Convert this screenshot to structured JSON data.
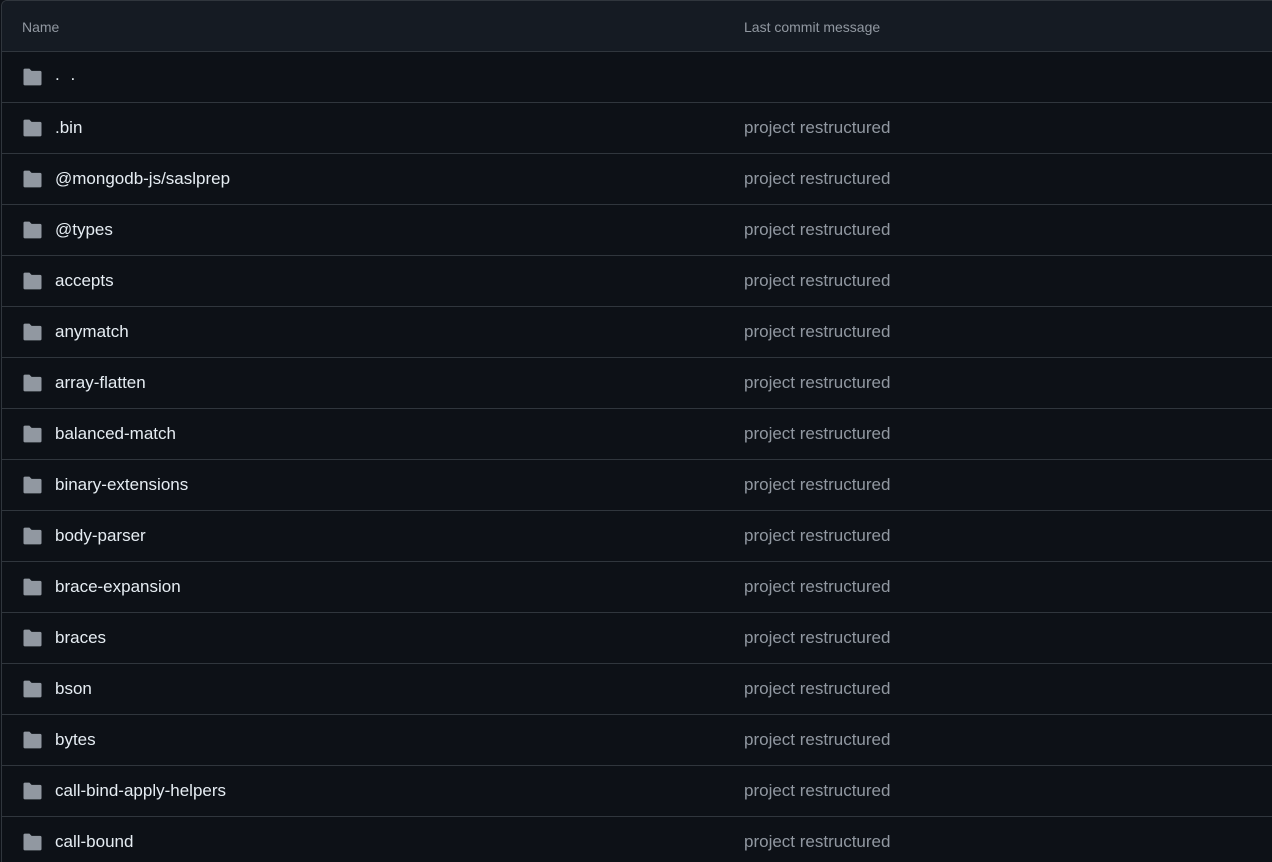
{
  "table": {
    "header": {
      "name": "Name",
      "last_commit_message": "Last commit message"
    },
    "parent_row": {
      "label": ". ."
    },
    "rows": [
      {
        "name": ".bin",
        "message": "project restructured"
      },
      {
        "name": "@mongodb-js/saslprep",
        "message": "project restructured"
      },
      {
        "name": "@types",
        "message": "project restructured"
      },
      {
        "name": "accepts",
        "message": "project restructured"
      },
      {
        "name": "anymatch",
        "message": "project restructured"
      },
      {
        "name": "array-flatten",
        "message": "project restructured"
      },
      {
        "name": "balanced-match",
        "message": "project restructured"
      },
      {
        "name": "binary-extensions",
        "message": "project restructured"
      },
      {
        "name": "body-parser",
        "message": "project restructured"
      },
      {
        "name": "brace-expansion",
        "message": "project restructured"
      },
      {
        "name": "braces",
        "message": "project restructured"
      },
      {
        "name": "bson",
        "message": "project restructured"
      },
      {
        "name": "bytes",
        "message": "project restructured"
      },
      {
        "name": "call-bind-apply-helpers",
        "message": "project restructured"
      },
      {
        "name": "call-bound",
        "message": "project restructured"
      }
    ]
  },
  "icons": {
    "folder": "folder-icon"
  },
  "colors": {
    "background": "#0d1117",
    "header_background": "#151b23",
    "border": "#30363d",
    "text_primary": "#e6edf3",
    "text_muted": "#9198a1",
    "folder_icon": "#9198a1"
  }
}
